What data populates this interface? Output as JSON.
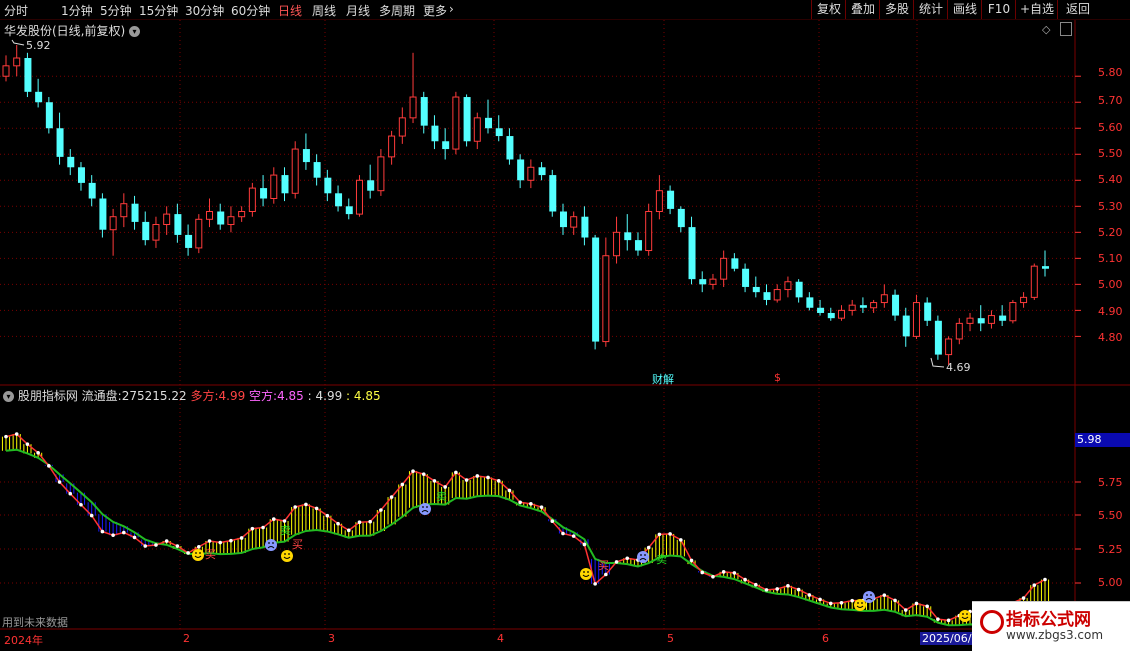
{
  "toolbar": {
    "periods": [
      "分时",
      "1分钟",
      "5分钟",
      "15分钟",
      "30分钟",
      "60分钟",
      "日线",
      "周线",
      "月线",
      "多周期",
      "更多"
    ],
    "active_period": "日线",
    "right_buttons": [
      "复权",
      "叠加",
      "多股",
      "统计",
      "画线",
      "F10",
      "+自选",
      "返回"
    ]
  },
  "main": {
    "title": "华发股份(日线,前复权)",
    "high_label": "5.92",
    "low_label": "4.69",
    "note_a": "财",
    "note_b": "解",
    "note_c": "$",
    "y_ticks": [
      "5.80",
      "5.70",
      "5.60",
      "5.50",
      "5.40",
      "5.30",
      "5.20",
      "5.10",
      "5.00",
      "4.90",
      "4.80"
    ]
  },
  "indicator": {
    "name": "股朋指标网",
    "float_label": "流通盘:",
    "float_value": "275215.22",
    "bull_label": "多方:",
    "bull_value": "4.99",
    "bear_label": "空方:",
    "bear_value": "4.85",
    "v3": ": 4.99",
    "v4": ": 4.85",
    "y_ticks": [
      "5.75",
      "5.50",
      "5.25",
      "5.00"
    ],
    "current_value": "5.98",
    "sell": "卖",
    "buy": "买",
    "future_note": "用到未来数据"
  },
  "dates": [
    "2024年",
    "2",
    "3",
    "4",
    "5",
    "6",
    "2025/06/"
  ],
  "watermark": {
    "title": "指标公式网",
    "url": "www.zbgs3.com"
  },
  "colors": {
    "up": "#ff3b3b",
    "down": "#54ffff",
    "grid": "#7a0000",
    "bull": "#ffff00",
    "bear": "#1a1aff",
    "line": "#22bb22"
  },
  "chart_data": {
    "type": "candlestick",
    "y_range": [
      4.69,
      5.92
    ],
    "candles_ohlc": [
      [
        5.8,
        5.88,
        5.78,
        5.84
      ],
      [
        5.84,
        5.92,
        5.8,
        5.87
      ],
      [
        5.87,
        5.89,
        5.72,
        5.74
      ],
      [
        5.74,
        5.79,
        5.68,
        5.7
      ],
      [
        5.7,
        5.72,
        5.58,
        5.6
      ],
      [
        5.6,
        5.66,
        5.46,
        5.49
      ],
      [
        5.49,
        5.52,
        5.42,
        5.45
      ],
      [
        5.45,
        5.47,
        5.36,
        5.39
      ],
      [
        5.39,
        5.42,
        5.3,
        5.33
      ],
      [
        5.33,
        5.35,
        5.18,
        5.21
      ],
      [
        5.21,
        5.29,
        5.11,
        5.26
      ],
      [
        5.26,
        5.35,
        5.22,
        5.31
      ],
      [
        5.31,
        5.34,
        5.21,
        5.24
      ],
      [
        5.24,
        5.28,
        5.15,
        5.17
      ],
      [
        5.17,
        5.26,
        5.14,
        5.23
      ],
      [
        5.23,
        5.3,
        5.19,
        5.27
      ],
      [
        5.27,
        5.31,
        5.16,
        5.19
      ],
      [
        5.19,
        5.23,
        5.11,
        5.14
      ],
      [
        5.14,
        5.27,
        5.12,
        5.25
      ],
      [
        5.25,
        5.33,
        5.22,
        5.28
      ],
      [
        5.28,
        5.31,
        5.21,
        5.23
      ],
      [
        5.23,
        5.3,
        5.2,
        5.26
      ],
      [
        5.26,
        5.3,
        5.24,
        5.28
      ],
      [
        5.28,
        5.39,
        5.26,
        5.37
      ],
      [
        5.37,
        5.42,
        5.3,
        5.33
      ],
      [
        5.33,
        5.45,
        5.31,
        5.42
      ],
      [
        5.42,
        5.45,
        5.32,
        5.35
      ],
      [
        5.35,
        5.55,
        5.33,
        5.52
      ],
      [
        5.52,
        5.58,
        5.44,
        5.47
      ],
      [
        5.47,
        5.5,
        5.38,
        5.41
      ],
      [
        5.41,
        5.44,
        5.32,
        5.35
      ],
      [
        5.35,
        5.38,
        5.28,
        5.3
      ],
      [
        5.3,
        5.33,
        5.25,
        5.27
      ],
      [
        5.27,
        5.42,
        5.26,
        5.4
      ],
      [
        5.4,
        5.46,
        5.33,
        5.36
      ],
      [
        5.36,
        5.52,
        5.34,
        5.49
      ],
      [
        5.49,
        5.59,
        5.46,
        5.57
      ],
      [
        5.57,
        5.68,
        5.54,
        5.64
      ],
      [
        5.64,
        5.89,
        5.62,
        5.72
      ],
      [
        5.72,
        5.74,
        5.58,
        5.61
      ],
      [
        5.61,
        5.65,
        5.52,
        5.55
      ],
      [
        5.55,
        5.6,
        5.48,
        5.52
      ],
      [
        5.52,
        5.74,
        5.5,
        5.72
      ],
      [
        5.72,
        5.73,
        5.53,
        5.55
      ],
      [
        5.55,
        5.66,
        5.52,
        5.64
      ],
      [
        5.64,
        5.71,
        5.58,
        5.6
      ],
      [
        5.6,
        5.65,
        5.55,
        5.57
      ],
      [
        5.57,
        5.6,
        5.46,
        5.48
      ],
      [
        5.48,
        5.5,
        5.37,
        5.4
      ],
      [
        5.4,
        5.48,
        5.37,
        5.45
      ],
      [
        5.45,
        5.47,
        5.4,
        5.42
      ],
      [
        5.42,
        5.44,
        5.26,
        5.28
      ],
      [
        5.28,
        5.31,
        5.19,
        5.22
      ],
      [
        5.22,
        5.28,
        5.19,
        5.26
      ],
      [
        5.26,
        5.3,
        5.15,
        5.18
      ],
      [
        5.18,
        5.19,
        4.75,
        4.78
      ],
      [
        4.78,
        5.18,
        4.76,
        5.11
      ],
      [
        5.11,
        5.26,
        5.08,
        5.2
      ],
      [
        5.2,
        5.27,
        5.13,
        5.17
      ],
      [
        5.17,
        5.2,
        5.11,
        5.13
      ],
      [
        5.13,
        5.31,
        5.11,
        5.28
      ],
      [
        5.28,
        5.42,
        5.25,
        5.36
      ],
      [
        5.36,
        5.38,
        5.27,
        5.29
      ],
      [
        5.29,
        5.3,
        5.2,
        5.22
      ],
      [
        5.22,
        5.26,
        5.0,
        5.02
      ],
      [
        5.02,
        5.05,
        4.97,
        5.0
      ],
      [
        5.0,
        5.04,
        4.98,
        5.02
      ],
      [
        5.02,
        5.13,
        4.99,
        5.1
      ],
      [
        5.1,
        5.12,
        5.05,
        5.06
      ],
      [
        5.06,
        5.08,
        4.97,
        4.99
      ],
      [
        4.99,
        5.03,
        4.95,
        4.97
      ],
      [
        4.97,
        5.0,
        4.92,
        4.94
      ],
      [
        4.94,
        5.0,
        4.93,
        4.98
      ],
      [
        4.98,
        5.03,
        4.95,
        5.01
      ],
      [
        5.01,
        5.02,
        4.93,
        4.95
      ],
      [
        4.95,
        4.97,
        4.9,
        4.91
      ],
      [
        4.91,
        4.94,
        4.88,
        4.89
      ],
      [
        4.89,
        4.91,
        4.86,
        4.87
      ],
      [
        4.87,
        4.92,
        4.86,
        4.9
      ],
      [
        4.9,
        4.94,
        4.88,
        4.92
      ],
      [
        4.92,
        4.95,
        4.89,
        4.91
      ],
      [
        4.91,
        4.94,
        4.89,
        4.93
      ],
      [
        4.93,
        5.0,
        4.91,
        4.96
      ],
      [
        4.96,
        4.98,
        4.86,
        4.88
      ],
      [
        4.88,
        4.91,
        4.76,
        4.8
      ],
      [
        4.8,
        4.96,
        4.79,
        4.93
      ],
      [
        4.93,
        4.95,
        4.84,
        4.86
      ],
      [
        4.86,
        4.88,
        4.71,
        4.73
      ],
      [
        4.73,
        4.8,
        4.69,
        4.79
      ],
      [
        4.79,
        4.87,
        4.77,
        4.85
      ],
      [
        4.85,
        4.89,
        4.82,
        4.87
      ],
      [
        4.87,
        4.92,
        4.82,
        4.85
      ],
      [
        4.85,
        4.9,
        4.83,
        4.88
      ],
      [
        4.88,
        4.92,
        4.84,
        4.86
      ],
      [
        4.86,
        4.94,
        4.85,
        4.93
      ],
      [
        4.93,
        4.97,
        4.91,
        4.95
      ],
      [
        4.95,
        5.08,
        4.94,
        5.07
      ],
      [
        5.07,
        5.13,
        5.03,
        5.06
      ]
    ]
  }
}
